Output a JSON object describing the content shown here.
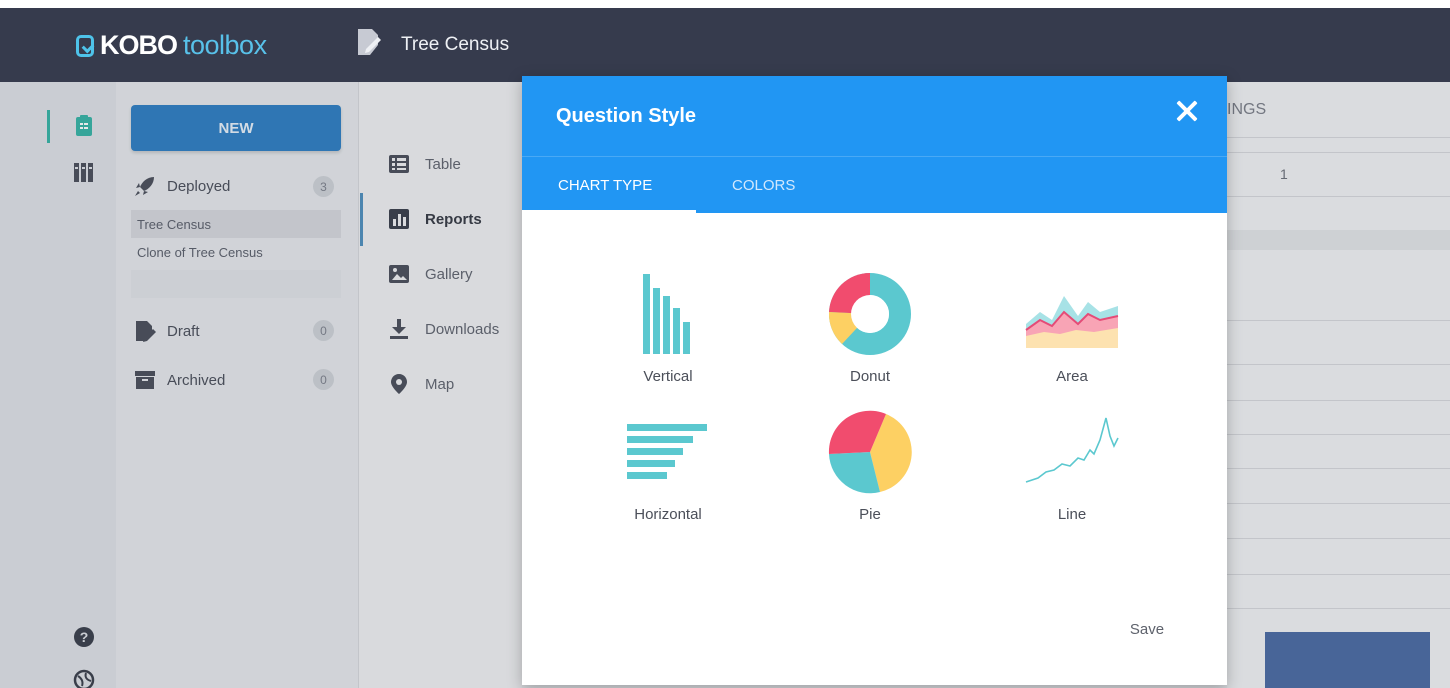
{
  "header": {
    "logo_primary": "KOBO",
    "logo_secondary": "toolbox",
    "form_title": "Tree Census"
  },
  "rail": {
    "icons": [
      "forms-icon",
      "library-icon",
      "help-icon",
      "language-icon"
    ]
  },
  "sidebar": {
    "new_button": "NEW",
    "groups": [
      {
        "label": "Deployed",
        "count": "3",
        "icon": "rocket-icon"
      },
      {
        "label": "Draft",
        "count": "0",
        "icon": "draft-icon"
      },
      {
        "label": "Archived",
        "count": "0",
        "icon": "archive-icon"
      }
    ],
    "deployed_items": [
      "Tree Census",
      "Clone of Tree Census"
    ]
  },
  "subnav": {
    "items": [
      {
        "label": "Table",
        "icon": "table-icon"
      },
      {
        "label": "Reports",
        "icon": "reports-icon"
      },
      {
        "label": "Gallery",
        "icon": "gallery-icon"
      },
      {
        "label": "Downloads",
        "icon": "download-icon"
      },
      {
        "label": "Map",
        "icon": "map-pin-icon"
      }
    ]
  },
  "background_report": {
    "tab_fragment": "INGS",
    "value": "1"
  },
  "modal": {
    "title": "Question Style",
    "tabs": [
      "CHART TYPE",
      "COLORS"
    ],
    "chart_types": [
      "Vertical",
      "Donut",
      "Area",
      "Horizontal",
      "Pie",
      "Line"
    ],
    "save_label": "Save"
  },
  "colors": {
    "header_bg": "#363b4d",
    "modal_header": "#2196f3",
    "accent_teal": "#5bc8cf",
    "accent_pink": "#f14c6e",
    "accent_yellow": "#fdd063",
    "new_button": "#2e7ec3"
  }
}
